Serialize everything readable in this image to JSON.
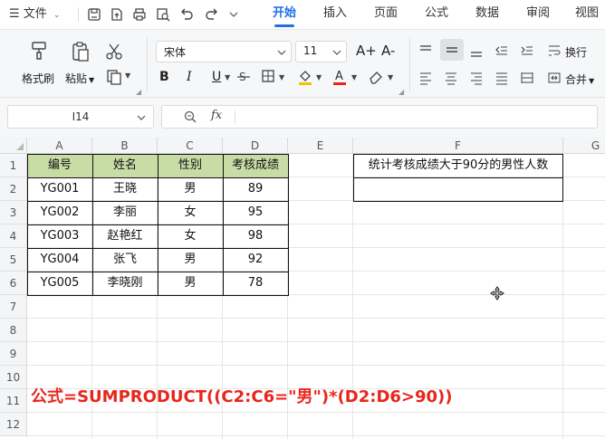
{
  "menubar": {
    "menu_label": "☰ 文件",
    "tabs": [
      {
        "label": "开始",
        "active": true
      },
      {
        "label": "插入"
      },
      {
        "label": "页面"
      },
      {
        "label": "公式"
      },
      {
        "label": "数据"
      },
      {
        "label": "审阅"
      },
      {
        "label": "视图"
      }
    ]
  },
  "ribbon": {
    "format_painter": "格式刷",
    "paste": "粘贴",
    "font_name": "宋体",
    "font_size": "11",
    "bold": "B",
    "italic": "I",
    "underline": "U",
    "wrap": "换行",
    "merge": "合并",
    "font_grow": "A+",
    "font_shrink": "A-",
    "font_color_hex": "#e8261c",
    "fill_color_hex": "#f5c400"
  },
  "formula_bar": {
    "cell_ref": "I14",
    "fx_label": "fx",
    "value": ""
  },
  "sheet": {
    "columns": [
      "A",
      "B",
      "C",
      "D",
      "E",
      "F",
      "G"
    ],
    "rows": [
      "1",
      "2",
      "3",
      "4",
      "5",
      "6",
      "7",
      "8",
      "9",
      "10",
      "11",
      "12"
    ],
    "table_headers": [
      "编号",
      "姓名",
      "性别",
      "考核成绩"
    ],
    "table_rows": [
      [
        "YG001",
        "王晓",
        "男",
        "89"
      ],
      [
        "YG002",
        "李丽",
        "女",
        "95"
      ],
      [
        "YG003",
        "赵艳红",
        "女",
        "98"
      ],
      [
        "YG004",
        "张飞",
        "男",
        "92"
      ],
      [
        "YG005",
        "李晓刚",
        "男",
        "78"
      ]
    ],
    "header_fill_hex": "#c8dca6",
    "f1_label": "统计考核成绩大于90分的男性人数",
    "f2_value": "",
    "formula_text": "公式=SUMPRODUCT((C2:C6=\"男\")*(D2:D6>90))",
    "formula_color_hex": "#e8261c"
  }
}
